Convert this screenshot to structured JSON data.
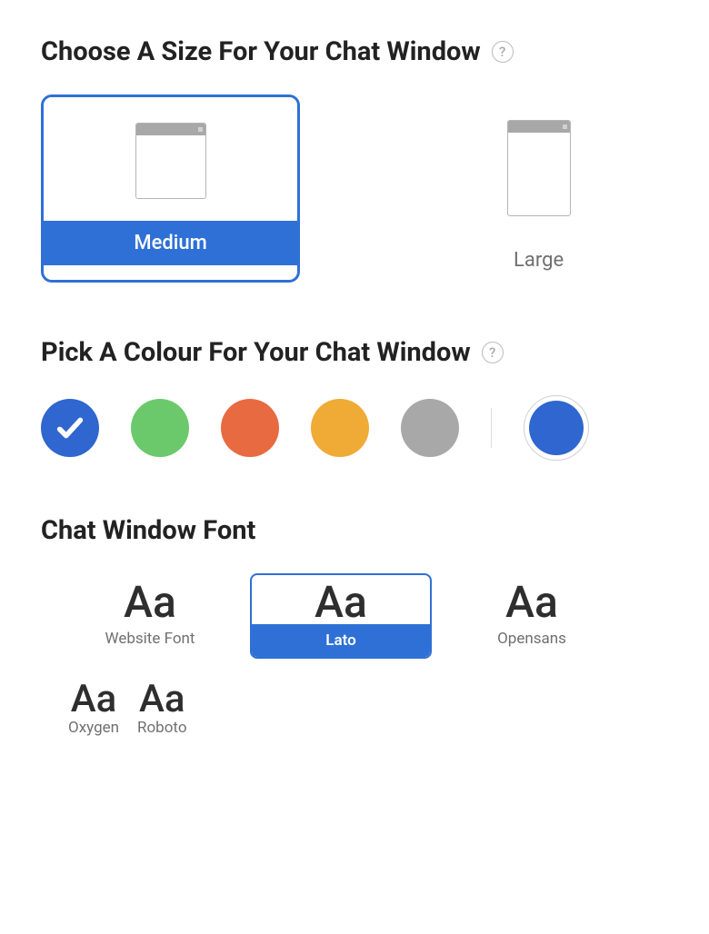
{
  "size": {
    "title": "Choose A Size For Your Chat Window",
    "options": [
      {
        "id": "medium",
        "label": "Medium",
        "selected": true
      },
      {
        "id": "large",
        "label": "Large",
        "selected": false
      }
    ]
  },
  "color": {
    "title": "Pick A Colour For Your Chat Window",
    "swatches": [
      {
        "id": "blue",
        "hex": "#2f66cf",
        "selected": true
      },
      {
        "id": "green",
        "hex": "#6bc96b",
        "selected": false
      },
      {
        "id": "orange",
        "hex": "#e86a41",
        "selected": false
      },
      {
        "id": "amber",
        "hex": "#f0aa36",
        "selected": false
      },
      {
        "id": "gray",
        "hex": "#a8a8a8",
        "selected": false
      }
    ],
    "custom": {
      "hex": "#2f66cf"
    }
  },
  "font": {
    "title": "Chat Window Font",
    "sample": "Aa",
    "options_row1": [
      {
        "id": "website-font",
        "label": "Website Font",
        "selected": false
      },
      {
        "id": "lato",
        "label": "Lato",
        "selected": true
      },
      {
        "id": "opensans",
        "label": "Opensans",
        "selected": false
      }
    ],
    "options_row2": [
      {
        "id": "oxygen",
        "label": "Oxygen",
        "selected": false
      },
      {
        "id": "roboto",
        "label": "Roboto",
        "selected": false
      }
    ]
  }
}
